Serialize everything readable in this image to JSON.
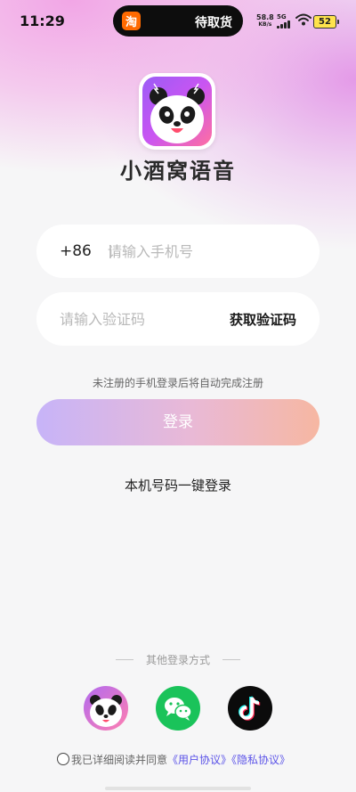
{
  "status_bar": {
    "time": "11:29",
    "island_app_icon": "淘",
    "island_text": "待取货",
    "net_speed_value": "58.8",
    "net_speed_unit": "KB/s",
    "network_type": "5G",
    "battery": "52"
  },
  "app": {
    "name": "小酒窝语音",
    "logo_icon": "panda-logo-icon",
    "brand_gradient": [
      "#9b5cf6",
      "#c955f2",
      "#ff6fa0"
    ]
  },
  "login_form": {
    "country_code": "+86",
    "phone_placeholder": "请输入手机号",
    "phone_value": "",
    "code_placeholder": "请输入验证码",
    "code_value": "",
    "get_code_label": "获取验证码",
    "hint": "未注册的手机登录后将自动完成注册",
    "login_label": "登录",
    "one_key_login_label": "本机号码一键登录"
  },
  "other_login": {
    "title": "其他登录方式",
    "methods": [
      {
        "icon": "panda-app-icon"
      },
      {
        "icon": "wechat-icon",
        "color": "#1ac35a"
      },
      {
        "icon": "tiktok-icon",
        "color": "#0b0b0b"
      }
    ]
  },
  "agreement": {
    "checked": false,
    "prefix": "我已详细阅读并同意",
    "user_agreement": "《用户协议》",
    "privacy_agreement": "《隐私协议》",
    "link_color": "#5b53e8"
  }
}
